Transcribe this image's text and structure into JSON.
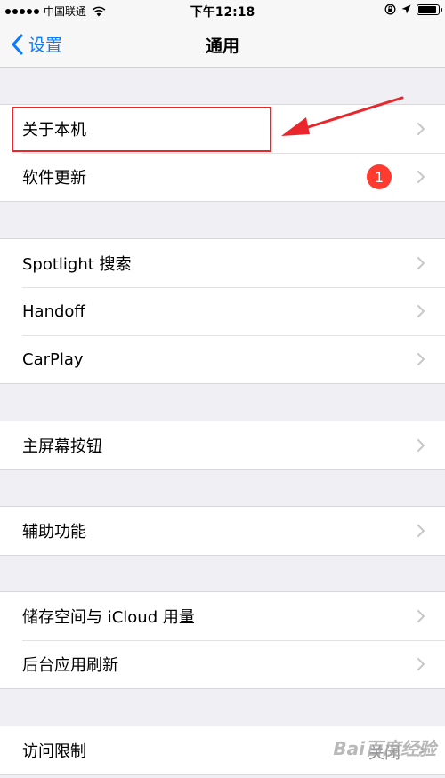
{
  "status_bar": {
    "carrier": "中国联通",
    "time": "下午12:18"
  },
  "nav": {
    "back_label": "设置",
    "title": "通用"
  },
  "groups": [
    {
      "rows": [
        {
          "label": "关于本机"
        },
        {
          "label": "软件更新",
          "badge": "1"
        }
      ]
    },
    {
      "rows": [
        {
          "label": "Spotlight 搜索"
        },
        {
          "label": "Handoff"
        },
        {
          "label": "CarPlay"
        }
      ]
    },
    {
      "rows": [
        {
          "label": "主屏幕按钮"
        }
      ]
    },
    {
      "rows": [
        {
          "label": "辅助功能"
        }
      ]
    },
    {
      "rows": [
        {
          "label": "储存空间与 iCloud 用量"
        },
        {
          "label": "后台应用刷新"
        }
      ]
    },
    {
      "rows": [
        {
          "label": "访问限制",
          "value": "关闭"
        }
      ]
    }
  ],
  "watermark": "Bai百度经验",
  "colors": {
    "accent": "#0a7bff",
    "badge": "#ff3b30",
    "annotation": "#e8262b"
  }
}
